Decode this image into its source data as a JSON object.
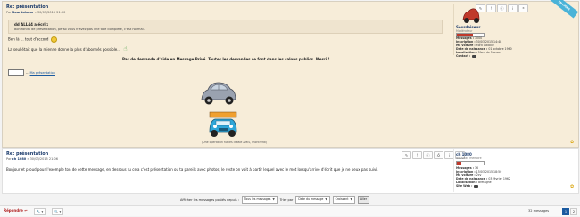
{
  "post1": {
    "title": "Re: présentation",
    "author_prefix": "Par",
    "author": "Sourdaiseur",
    "date": "» 30/03/2015 21:00",
    "toolbar": [
      "✎",
      "!",
      "ⓘ",
      "i",
      "❝"
    ],
    "quote_header": "dd ALL44 a écrit:",
    "quote_text": "Bon fondu de présentation, perso vous n'avez pas une tôle complète, c'est normal.",
    "line1": "Ben là ... tout d'accord",
    "line2": "La seul était que la mienne donne la plus d'abonnés possible...",
    "center_line": "Pas de demande d'aide en Message Privé. Toutes les demandes se font dans les salons publics. Merci !",
    "sig_link": "Ma présentation",
    "caption": "(Une opération futiles idéale AMIS, montrerai)",
    "corner_ribbon": "EN LIGNE"
  },
  "profile1": {
    "name": "Sourdaiseur",
    "rank": "Modérateur",
    "rank_fill": 0.6,
    "stats": [
      {
        "label": "Messages :",
        "value": "3000"
      },
      {
        "label": "Inscription :",
        "value": "30/03/2015 14:48"
      },
      {
        "label": "Ma voiture :",
        "value": "Ford Galaxie"
      },
      {
        "label": "Date de naissance :",
        "value": "01 octobre 1960"
      },
      {
        "label": "Localisation :",
        "value": "Mont de Marsan"
      },
      {
        "label": "Contact :",
        "value": ""
      }
    ]
  },
  "post2": {
    "title": "Re: présentation",
    "author_prefix": "Par",
    "author": "ch 1080",
    "date": "» 30/03/2015 21:06",
    "toolbar": [
      "✎",
      "!",
      "ⓘ",
      "⎙",
      "i",
      "❝"
    ],
    "text": "Bonjour et proud pour l'exemple ton de cette message, en dessous tu cela c'est présentation ou ta pareils avec photos, le reste on voit à partir lequel avec le mot lorsqu'arrivé d'écrit que je ne peux pas suivi."
  },
  "profile2": {
    "name": "ch 1080",
    "rank": "Nouveau membre",
    "rank_fill": 0.15,
    "stats": [
      {
        "label": "Messages :",
        "value": "36"
      },
      {
        "label": "Inscription :",
        "value": "15/03/2015 18:50"
      },
      {
        "label": "Ma voiture :",
        "value": "2cv"
      },
      {
        "label": "Date de naissance :",
        "value": "03 février 1962"
      },
      {
        "label": "Localisation :",
        "value": "Bretagne"
      },
      {
        "label": "Site Web :",
        "value": ""
      }
    ]
  },
  "filter": {
    "label": "Afficher les messages postés depuis :",
    "since": "Tous les messages",
    "sort_label": "Trier par",
    "sort": "Date du message",
    "order": "Croissant",
    "go": "Aller"
  },
  "footer": {
    "reply": "Répondre",
    "messages": "32 messages",
    "pages": [
      "1",
      "2"
    ]
  },
  "colors": {
    "post_bg": "#f7edd9",
    "title": "#1a3a6b",
    "accent": "#c0392b",
    "ribbon": "#4ab3d8"
  }
}
